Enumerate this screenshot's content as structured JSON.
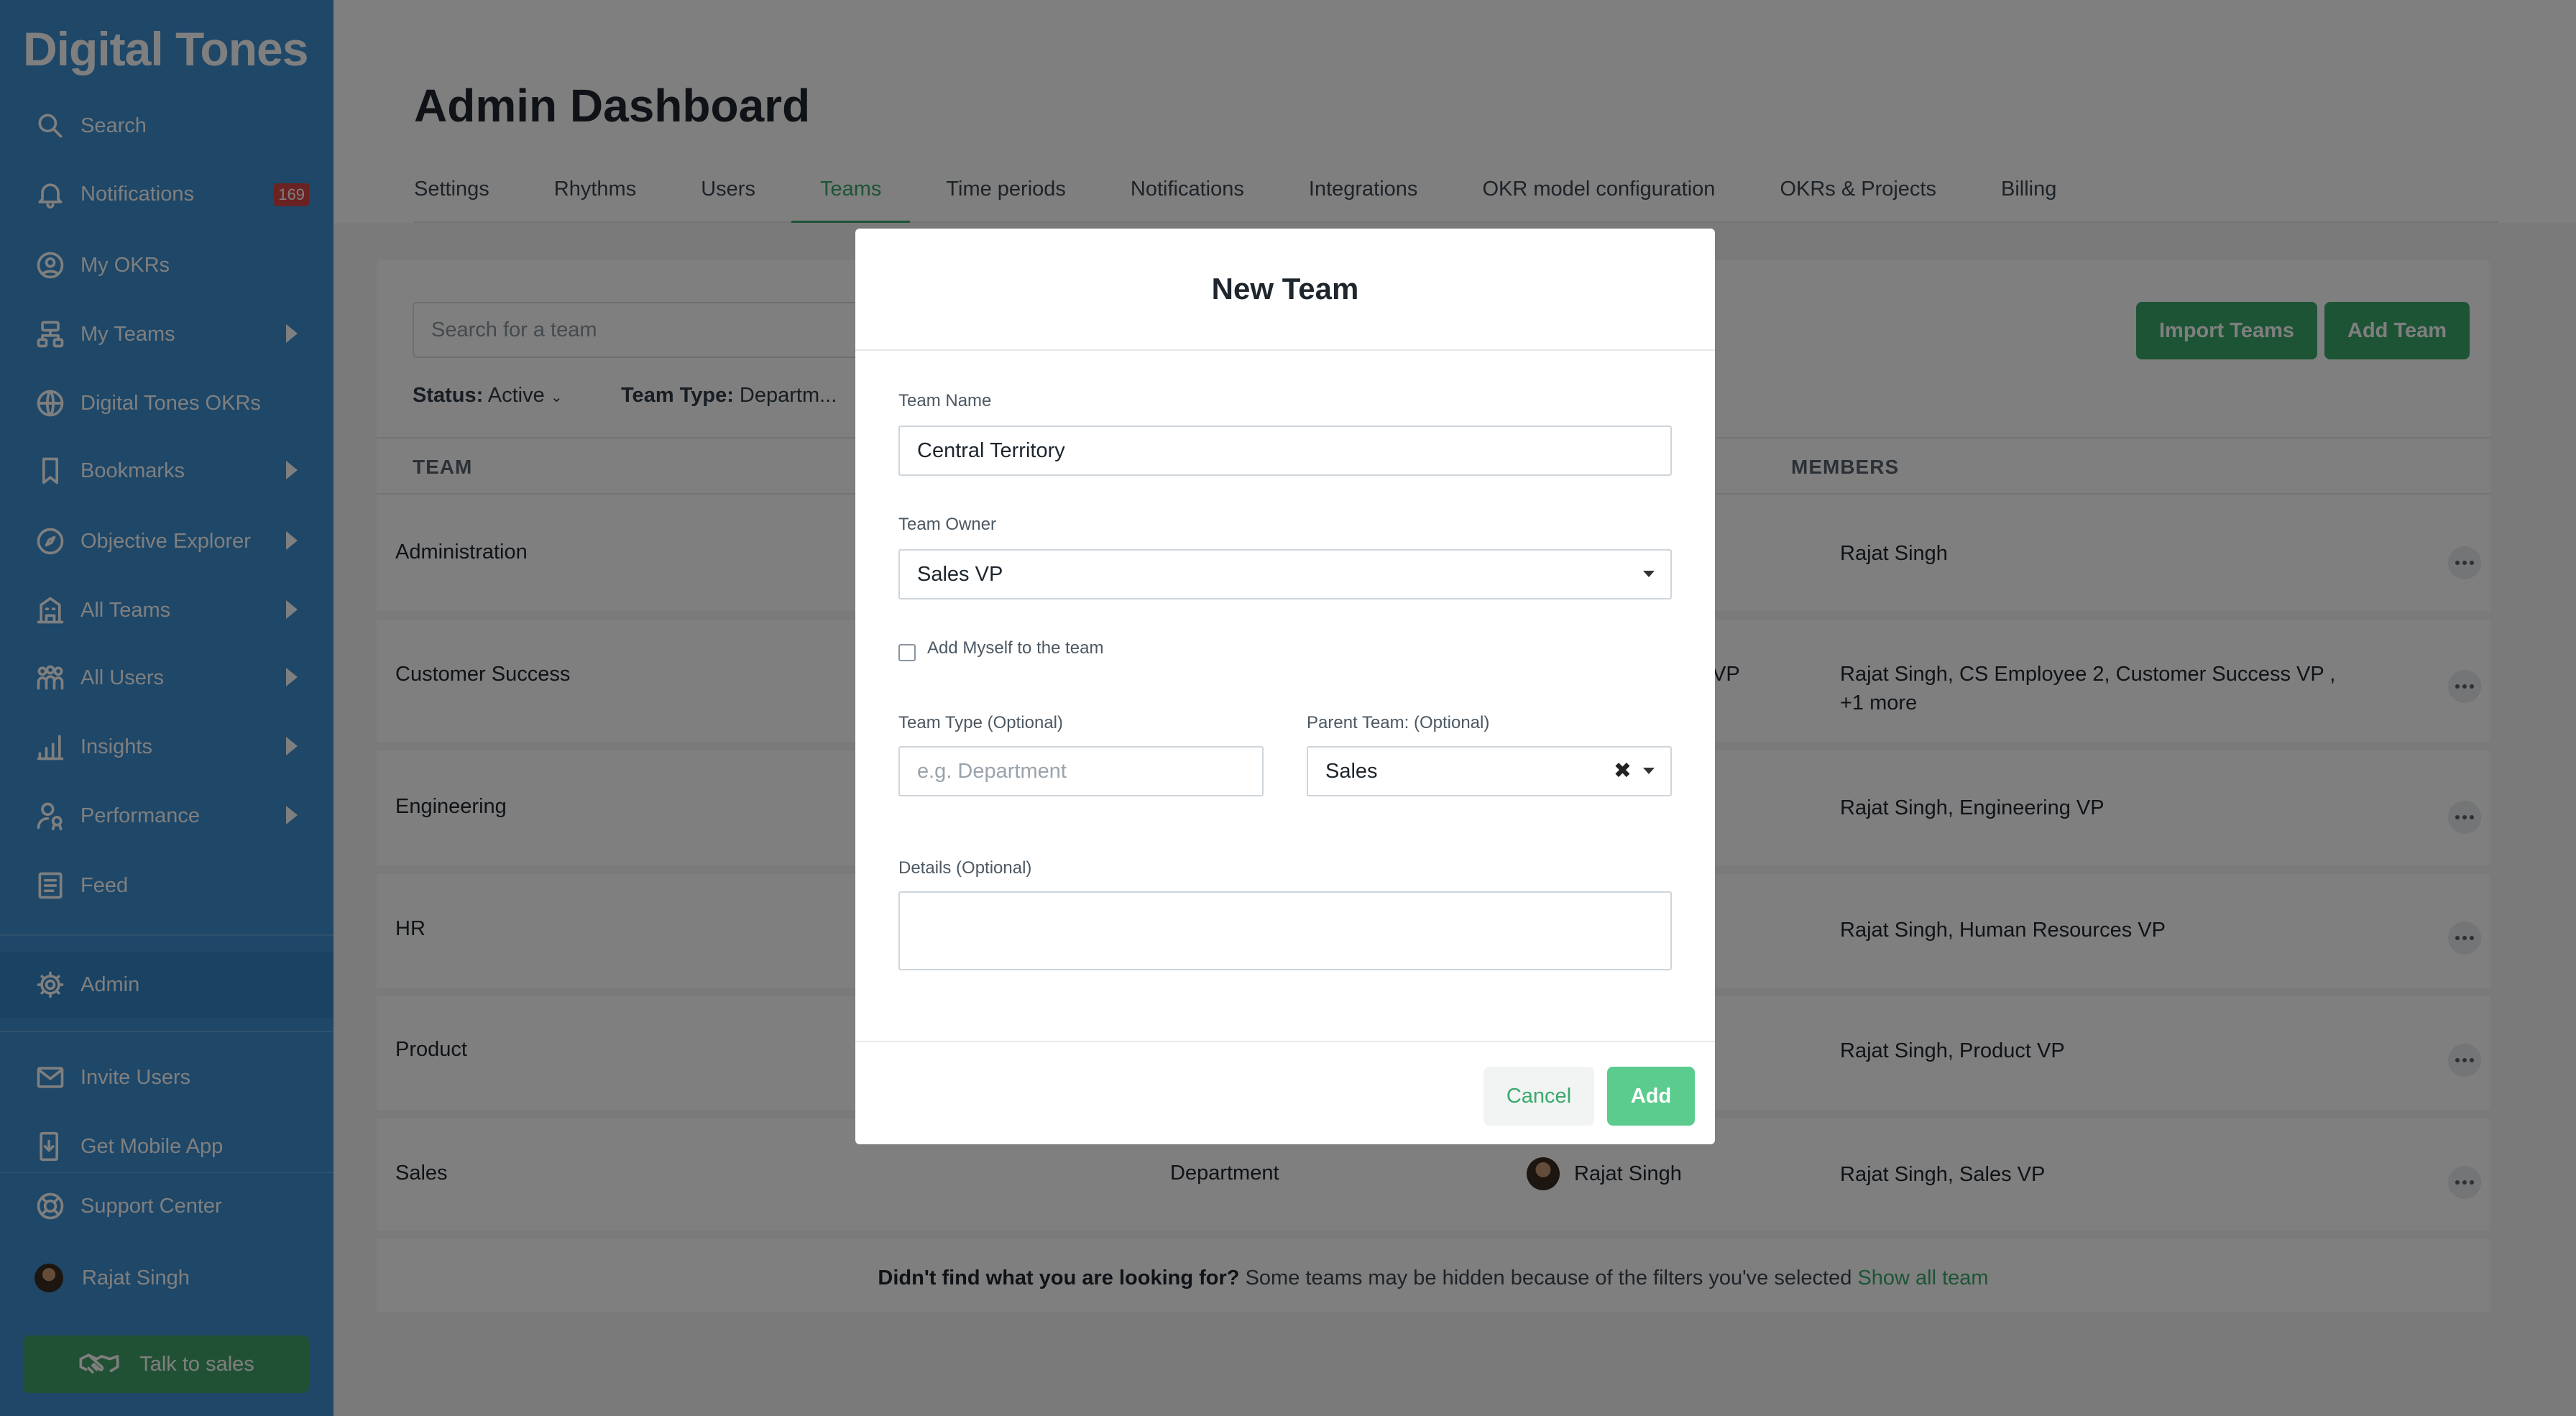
{
  "sidebar": {
    "brand": "Digital Tones",
    "items": [
      {
        "label": "Search",
        "icon": "search-icon"
      },
      {
        "label": "Notifications",
        "icon": "bell-icon",
        "badge": "169"
      },
      {
        "label": "My OKRs",
        "icon": "user-circle-icon"
      },
      {
        "label": "My Teams",
        "icon": "team-tree-icon"
      },
      {
        "label": "Digital Tones OKRs",
        "icon": "globe-icon"
      },
      {
        "label": "Bookmarks",
        "icon": "bookmark-icon"
      },
      {
        "label": "Objective Explorer",
        "icon": "compass-icon"
      },
      {
        "label": "All Teams",
        "icon": "building-icon"
      },
      {
        "label": "All Users",
        "icon": "users-icon"
      },
      {
        "label": "Insights",
        "icon": "chart-icon"
      },
      {
        "label": "Performance",
        "icon": "person-award-icon"
      },
      {
        "label": "Feed",
        "icon": "feed-icon"
      },
      {
        "label": "Admin",
        "icon": "gear-icon"
      },
      {
        "label": "Invite Users",
        "icon": "mail-icon"
      },
      {
        "label": "Get Mobile App",
        "icon": "mobile-download-icon"
      },
      {
        "label": "Support Center",
        "icon": "lifebuoy-icon"
      },
      {
        "label": "Rajat Singh",
        "icon": "avatar"
      }
    ],
    "talk_to_sales": "Talk to sales"
  },
  "header": {
    "title": "Admin Dashboard",
    "tabs": [
      "Settings",
      "Rhythms",
      "Users",
      "Teams",
      "Time periods",
      "Notifications",
      "Integrations",
      "OKR model configuration",
      "OKRs & Projects",
      "Billing"
    ],
    "selected_tab": "Teams"
  },
  "toolbar": {
    "search_placeholder": "Search for a team",
    "status_label": "Status:",
    "status_value": "Active",
    "team_type_label": "Team Type:",
    "team_type_value": "Departm...",
    "import_button": "Import Teams",
    "add_button": "Add Team"
  },
  "table": {
    "col_team": "TEAM",
    "col_members": "MEMBERS",
    "rows": [
      {
        "team": "Administration",
        "members": "Rajat Singh"
      },
      {
        "team": "Customer Success",
        "members": "Rajat Singh, CS Employee 2, Customer Success VP ,",
        "members_more": "+1 more",
        "owner_partial": "VP"
      },
      {
        "team": "Engineering",
        "members": "Rajat Singh, Engineering VP"
      },
      {
        "team": "HR",
        "members": "Rajat Singh, Human Resources VP"
      },
      {
        "team": "Product",
        "members": "Rajat Singh, Product VP"
      },
      {
        "team": "Sales",
        "type": "Department",
        "owner": "Rajat Singh",
        "members": "Rajat Singh, Sales VP"
      }
    ]
  },
  "footer": {
    "bold": "Didn't find what you are looking for?",
    "text": "Some teams may be hidden because of the filters you've selected",
    "link": "Show all team"
  },
  "modal": {
    "title": "New Team",
    "team_name_label": "Team Name",
    "team_name_value": "Central Territory",
    "team_owner_label": "Team Owner",
    "team_owner_value": "Sales VP",
    "add_myself_label": "Add Myself to the team",
    "team_type_label": "Team Type (Optional)",
    "team_type_placeholder": "e.g. Department",
    "parent_team_label": "Parent Team: (Optional)",
    "parent_team_value": "Sales",
    "details_label": "Details (Optional)",
    "cancel": "Cancel",
    "add": "Add"
  },
  "colors": {
    "sidebar": "#3c8fd0",
    "accent": "#3aa86b",
    "add_button": "#5bcb8e",
    "badge": "#d64545"
  }
}
